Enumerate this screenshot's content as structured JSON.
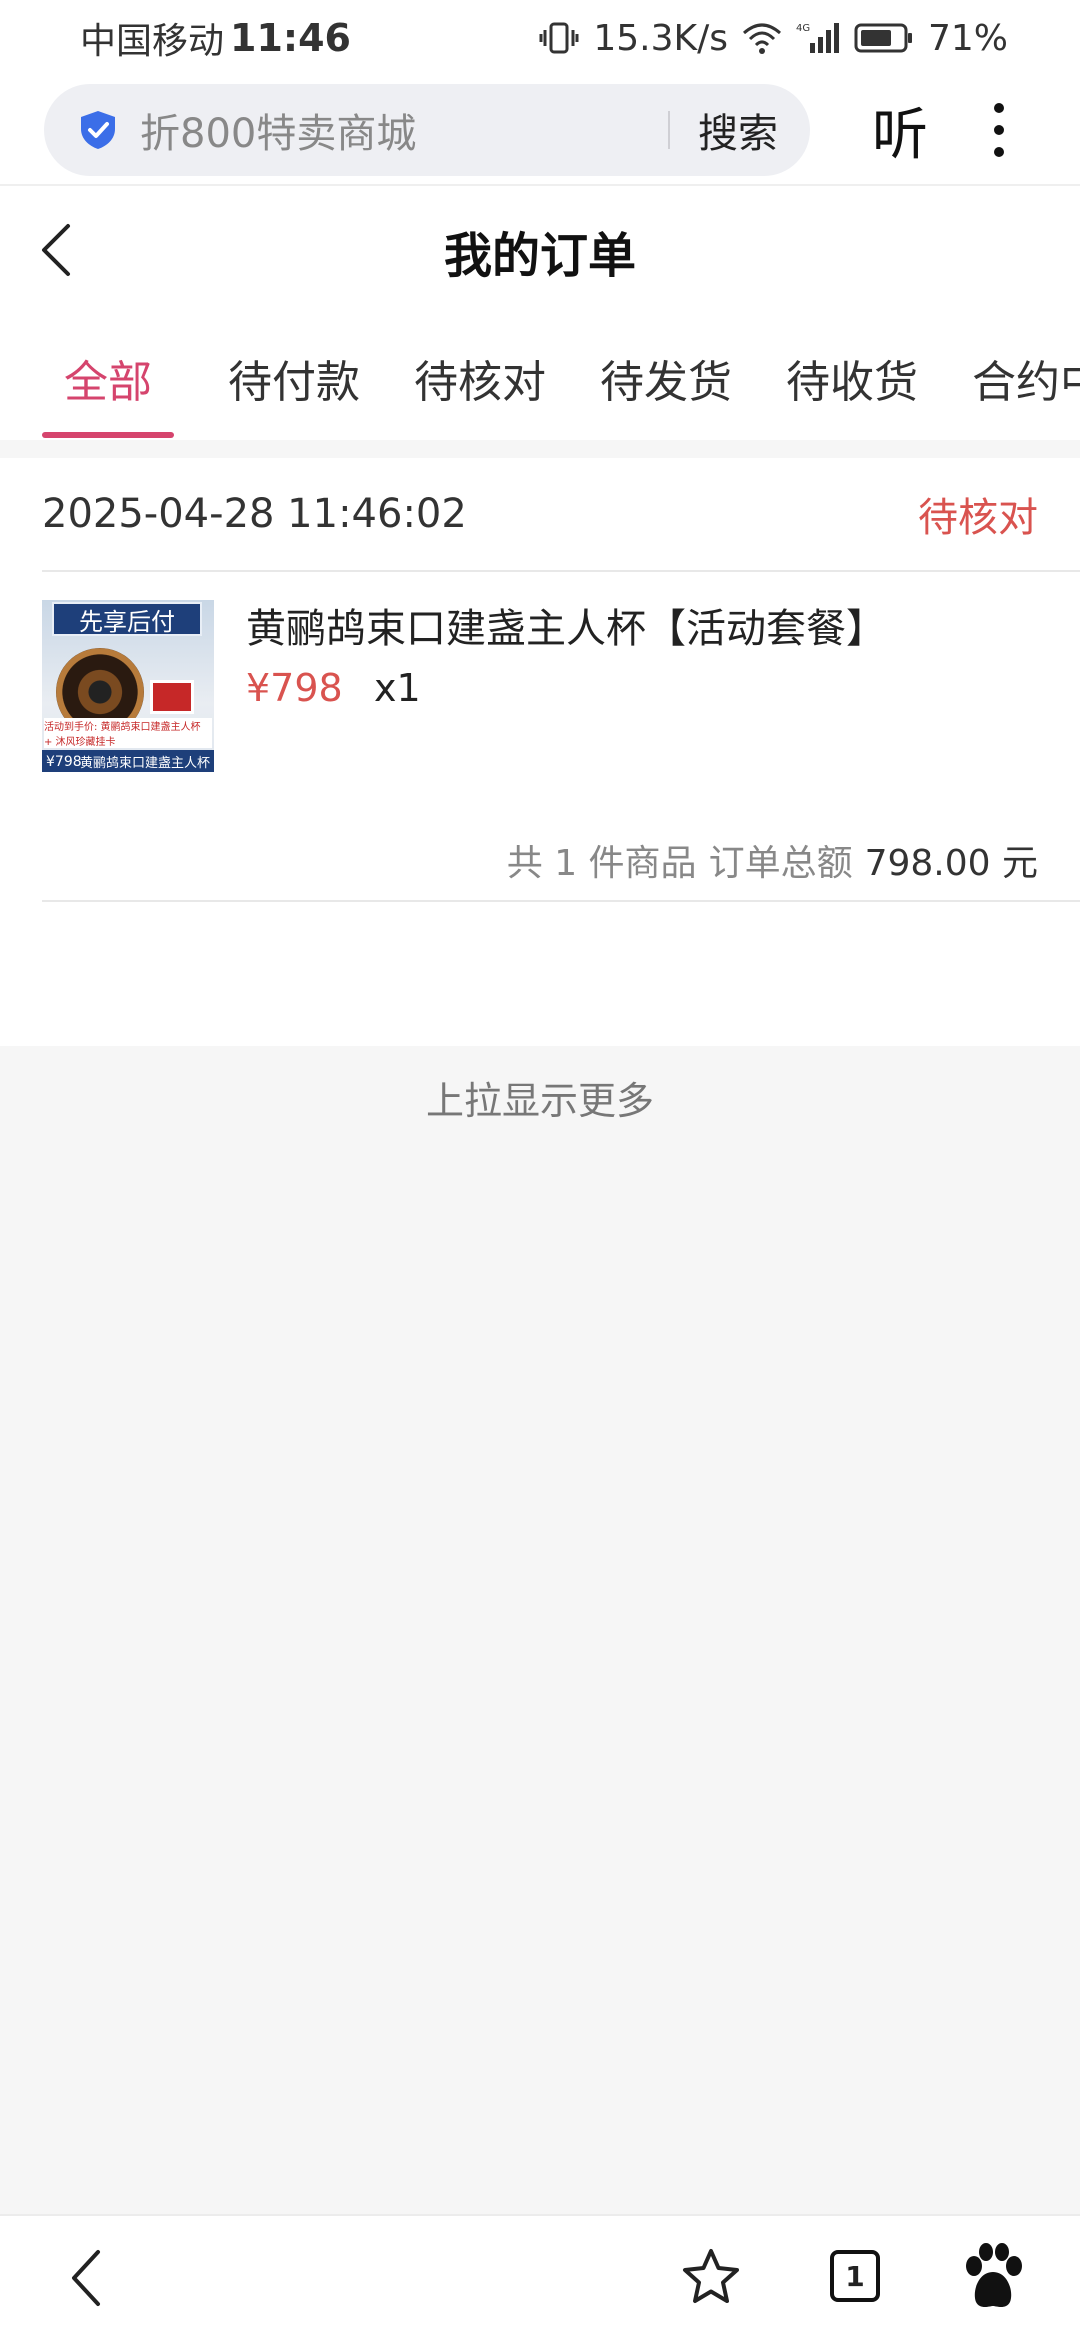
{
  "status_bar": {
    "carrier": "中国移动",
    "time": "11:46",
    "net_speed": "15.3K/s",
    "battery": "71%",
    "network_tag": "4G"
  },
  "browser": {
    "url_text": "折800特卖商城",
    "search_label": "搜索",
    "listen_label": "听"
  },
  "page": {
    "title": "我的订单"
  },
  "tabs": [
    {
      "label": "全部",
      "active": true
    },
    {
      "label": "待付款",
      "active": false
    },
    {
      "label": "待核对",
      "active": false
    },
    {
      "label": "待发货",
      "active": false
    },
    {
      "label": "待收货",
      "active": false
    },
    {
      "label": "合约中",
      "active": false
    }
  ],
  "order": {
    "datetime": "2025-04-28 11:46:02",
    "status": "待核对",
    "product": {
      "title": "黄鹂鸪束口建盏主人杯【活动套餐】",
      "price": "¥798",
      "qty": "x1",
      "thumb_tag": "先享后付",
      "thumb_caption": "黄鹂鸪束口建盏主人杯",
      "thumb_price": "¥798",
      "thumb_promo": "活动到手价: 黄鹂鸪束口建盏主人杯 + 沐风珍藏挂卡"
    },
    "summary_count": "共 1 件商品",
    "summary_total_label": "订单总额",
    "summary_total_value": "798.00 元"
  },
  "load_more": "上拉显示更多",
  "bottom_bar": {
    "tab_count": "1"
  },
  "colors": {
    "accent": "#d5446d",
    "status_red": "#d9534f",
    "shield_blue": "#3b6ee8"
  }
}
